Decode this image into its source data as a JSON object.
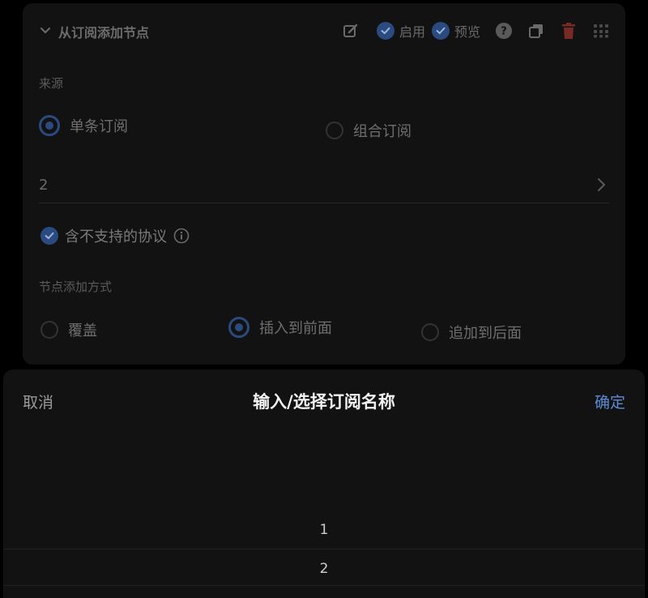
{
  "card": {
    "title": "从订阅添加节点",
    "enable_label": "启用",
    "preview_label": "预览",
    "source_label": "来源",
    "source_options": [
      "单条订阅",
      "组合订阅"
    ],
    "source_selected": "单条订阅",
    "subscription_value": "2",
    "include_unsupported_label": "含不支持的协议",
    "add_mode_label": "节点添加方式",
    "add_mode_options": [
      "覆盖",
      "插入到前面",
      "追加到后面"
    ],
    "add_mode_selected": "插入到前面"
  },
  "sheet": {
    "cancel_label": "取消",
    "title": "输入/选择订阅名称",
    "confirm_label": "确定",
    "options": [
      "1",
      "2"
    ],
    "selected": "2"
  },
  "colors": {
    "accent": "#5a8cd8",
    "check_bg": "#2a4a80",
    "delete_icon": "#7a2a26",
    "sheet_bg": "#121212"
  }
}
